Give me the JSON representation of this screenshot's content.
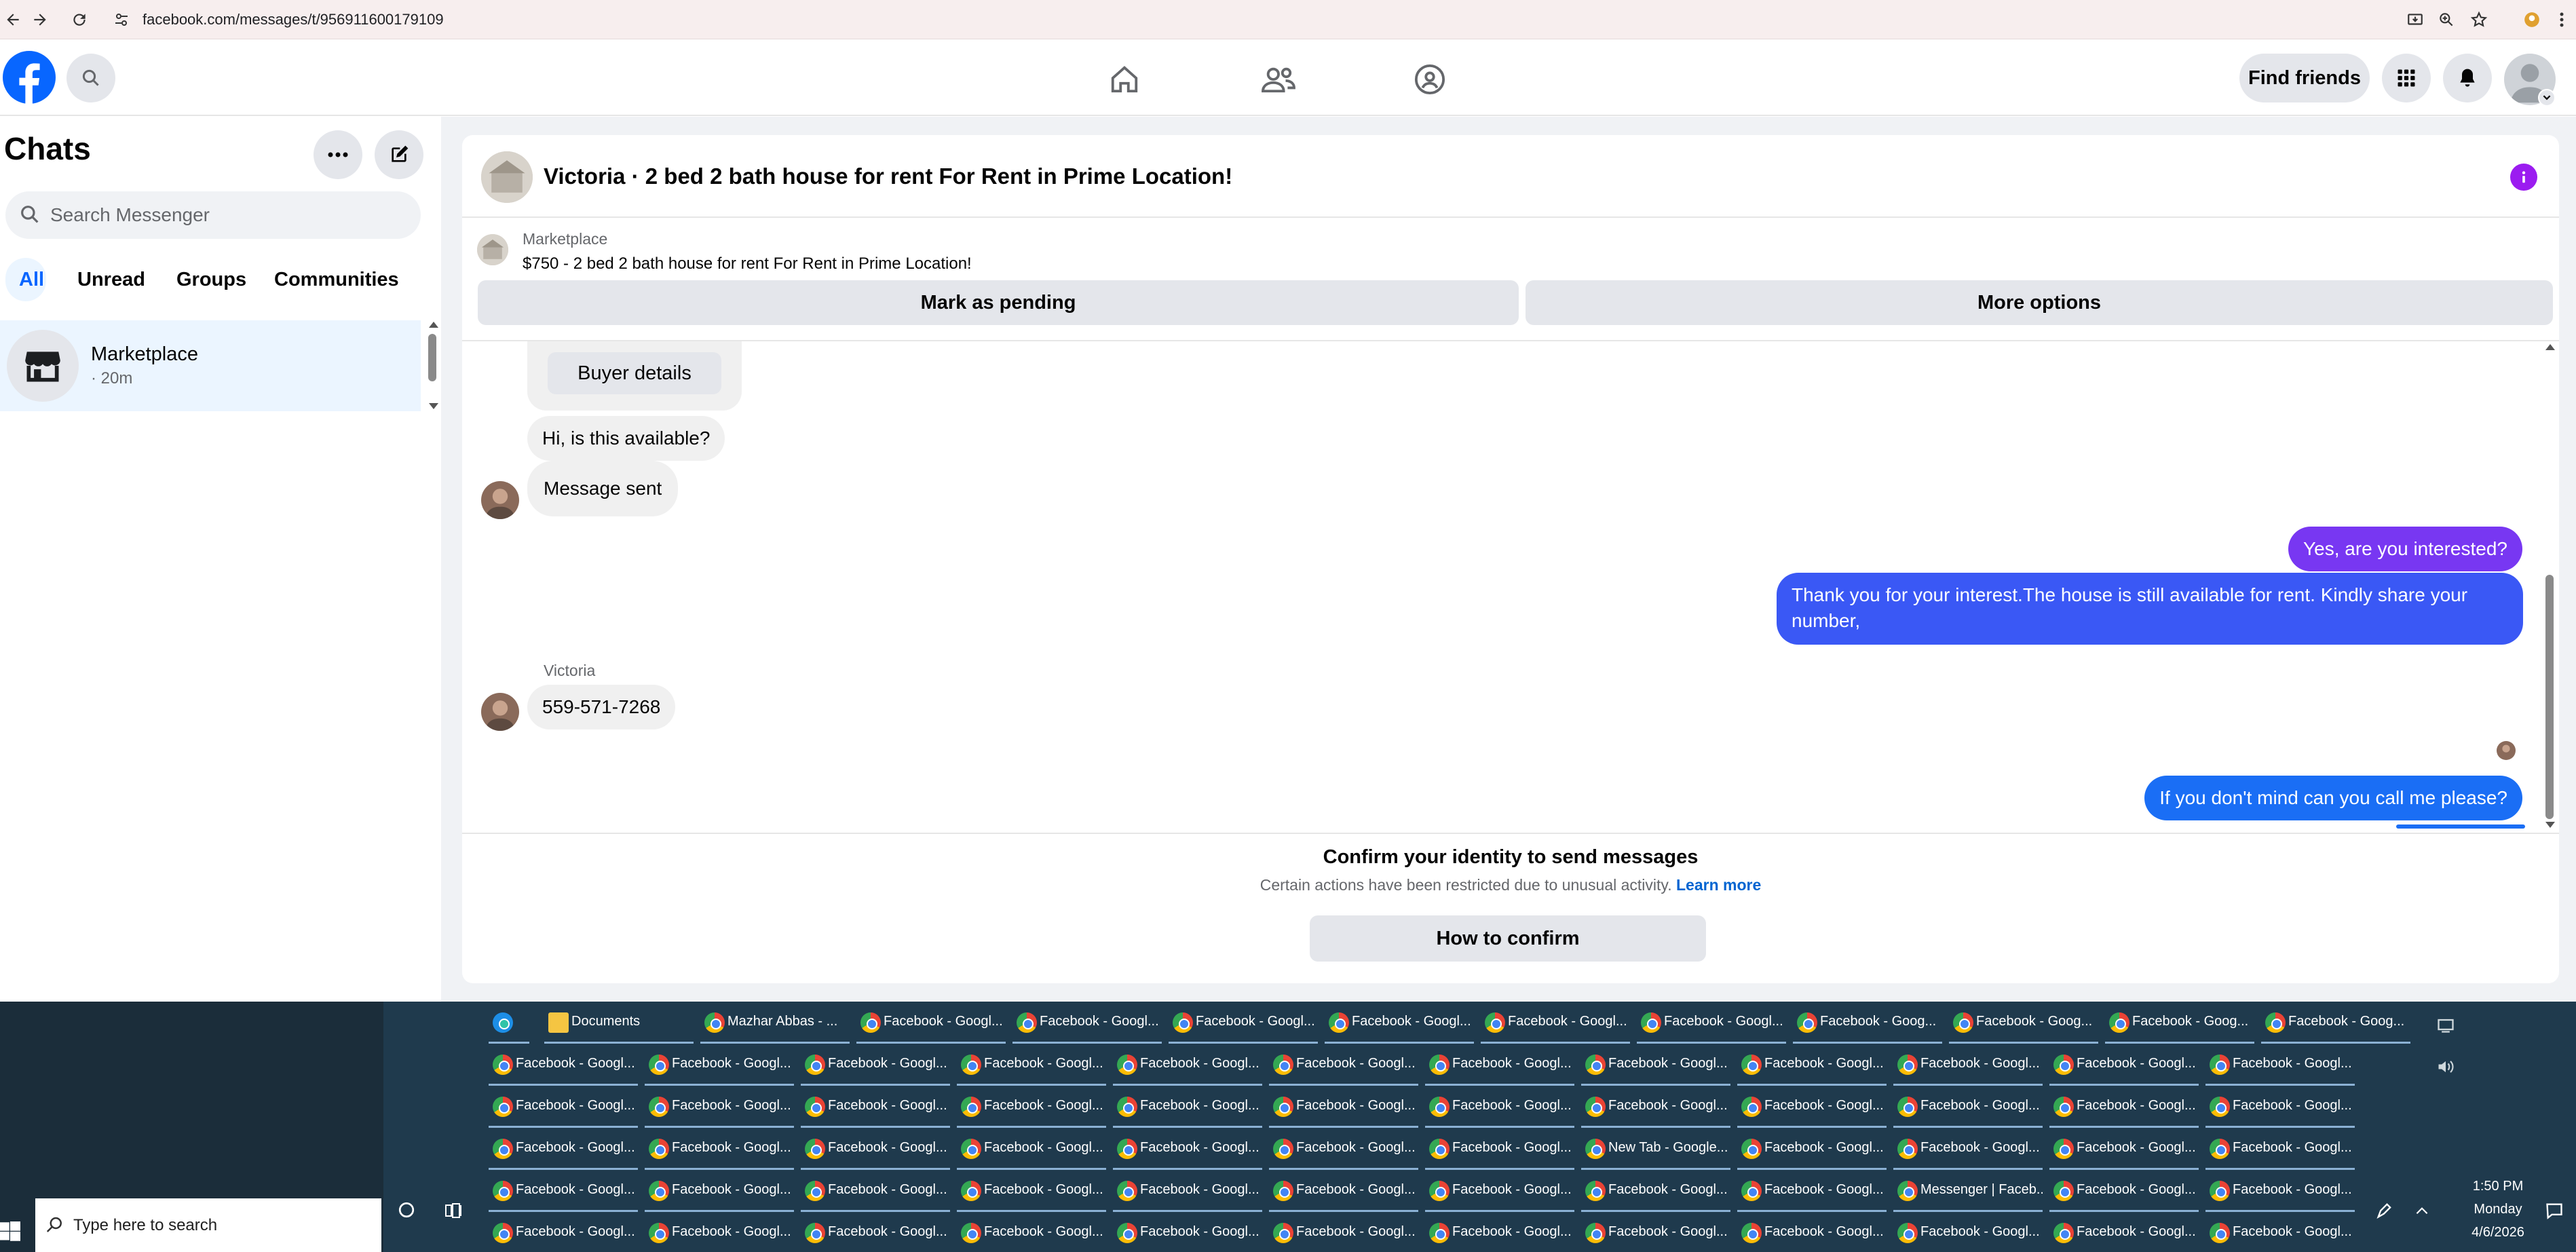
{
  "browser": {
    "url": "facebook.com/messages/t/956911600179109"
  },
  "header": {
    "find_friends": "Find friends"
  },
  "sidebar": {
    "title": "Chats",
    "search_placeholder": "Search Messenger",
    "filters": [
      "All",
      "Unread",
      "Groups",
      "Communities"
    ],
    "chats": [
      {
        "name": "Marketplace",
        "time": "· 20m"
      }
    ]
  },
  "conversation": {
    "title": "Victoria · 2 bed 2 bath house for rent For Rent in Prime Location!",
    "listing_label": "Marketplace",
    "listing_text": "$750 - 2 bed 2 bath house for rent For Rent in Prime Location!",
    "mark_pending": "Mark as pending",
    "more_options": "More options",
    "buyer_details": "Buyer details",
    "messages": [
      {
        "sender": "them",
        "text": "Hi, is this available?"
      },
      {
        "sender": "them",
        "text": "Message sent"
      },
      {
        "sender": "me",
        "text": "Yes, are you interested?"
      },
      {
        "sender": "me",
        "text": "Thank you for your interest.The house is still available for rent. Kindly share your number,"
      },
      {
        "sender_name": "Victoria",
        "sender": "them",
        "text": "559-571-7268"
      },
      {
        "sender": "me",
        "text": "If you don't mind can you call me please?"
      }
    ],
    "confirm_title": "Confirm your identity to send messages",
    "confirm_text": "Certain actions have been restricted due to unusual activity.",
    "learn_more": "Learn more",
    "how_to_confirm": "How to confirm"
  },
  "taskbar": {
    "search_placeholder": "Type here to search",
    "time": "1:50 PM",
    "day": "Monday",
    "date": "4/6/2026",
    "row1": [
      "",
      "Documents",
      "Mazhar Abbas - ...",
      "Facebook - Googl...",
      "Facebook - Googl...",
      "Facebook - Googl...",
      "Facebook - Googl...",
      "Facebook - Googl...",
      "Facebook - Googl...",
      "Facebook - Goog...",
      "Facebook - Goog...",
      "Facebook - Goog...",
      "Facebook - Goog..."
    ],
    "row2": [
      "Facebook - Googl...",
      "Facebook - Googl...",
      "Facebook - Googl...",
      "Facebook - Googl...",
      "Facebook - Googl...",
      "Facebook - Googl...",
      "Facebook - Googl...",
      "Facebook - Googl...",
      "Facebook - Googl...",
      "Facebook - Googl...",
      "Facebook - Googl...",
      "Facebook - Googl..."
    ],
    "row3": [
      "Facebook - Googl...",
      "Facebook - Googl...",
      "Facebook - Googl...",
      "Facebook - Googl...",
      "Facebook - Googl...",
      "Facebook - Googl...",
      "Facebook - Googl...",
      "Facebook - Googl...",
      "Facebook - Googl...",
      "Facebook - Googl...",
      "Facebook - Googl...",
      "Facebook - Googl..."
    ],
    "row4": [
      "Facebook - Googl...",
      "Facebook - Googl...",
      "Facebook - Googl...",
      "Facebook - Googl...",
      "Facebook - Googl...",
      "Facebook - Googl...",
      "Facebook - Googl...",
      "New Tab - Google...",
      "Facebook - Googl...",
      "Facebook - Googl...",
      "Facebook - Googl...",
      "Facebook - Googl..."
    ],
    "row5": [
      "Facebook - Googl...",
      "Facebook - Googl...",
      "Facebook - Googl...",
      "Facebook - Googl...",
      "Facebook - Googl...",
      "Facebook - Googl...",
      "Facebook - Googl...",
      "Facebook - Googl...",
      "Facebook - Googl...",
      "Messenger | Faceb...",
      "Facebook - Googl...",
      "Facebook - Googl..."
    ],
    "row6": [
      "Facebook - Googl...",
      "Facebook - Googl...",
      "Facebook - Googl...",
      "Facebook - Googl...",
      "Facebook - Googl...",
      "Facebook - Googl...",
      "Facebook - Googl...",
      "Facebook - Googl...",
      "Facebook - Googl...",
      "Facebook - Googl...",
      "Facebook - Googl...",
      "Facebook - Googl..."
    ]
  }
}
